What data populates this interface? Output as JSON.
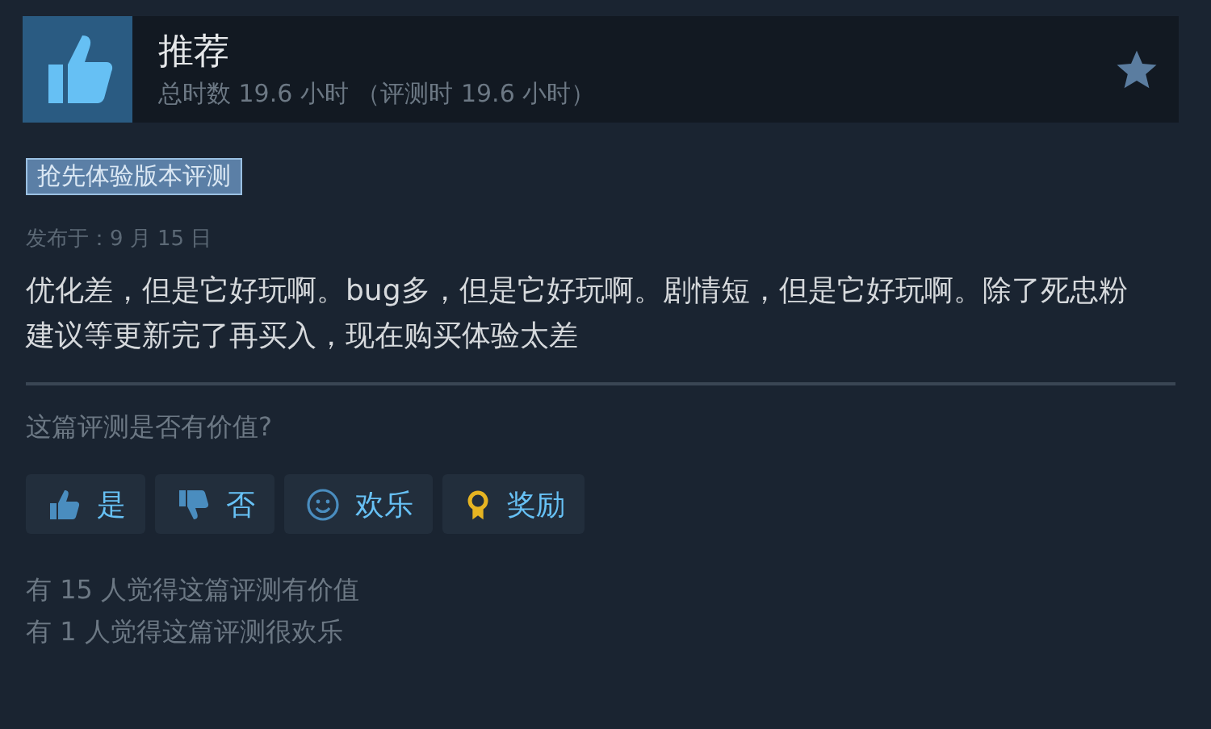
{
  "header": {
    "verdict": "推荐",
    "recommended": true,
    "playtime": "总时数 19.6 小时 （评测时 19.6 小时）"
  },
  "badge": "抢先体验版本评测",
  "posted": "发布于：9 月 15 日",
  "review": "优化差，但是它好玩啊。bug多，但是它好玩啊。剧情短，但是它好玩啊。除了死忠粉建议等更新完了再买入，现在购买体验太差",
  "question": "这篇评测是否有价值?",
  "buttons": [
    {
      "kind": "yes",
      "label": "是"
    },
    {
      "kind": "no",
      "label": "否"
    },
    {
      "kind": "funny",
      "label": "欢乐"
    },
    {
      "kind": "award",
      "label": "奖励"
    }
  ],
  "stats": [
    "有 15 人觉得这篇评测有价值",
    "有 1 人觉得这篇评测很欢乐"
  ]
}
